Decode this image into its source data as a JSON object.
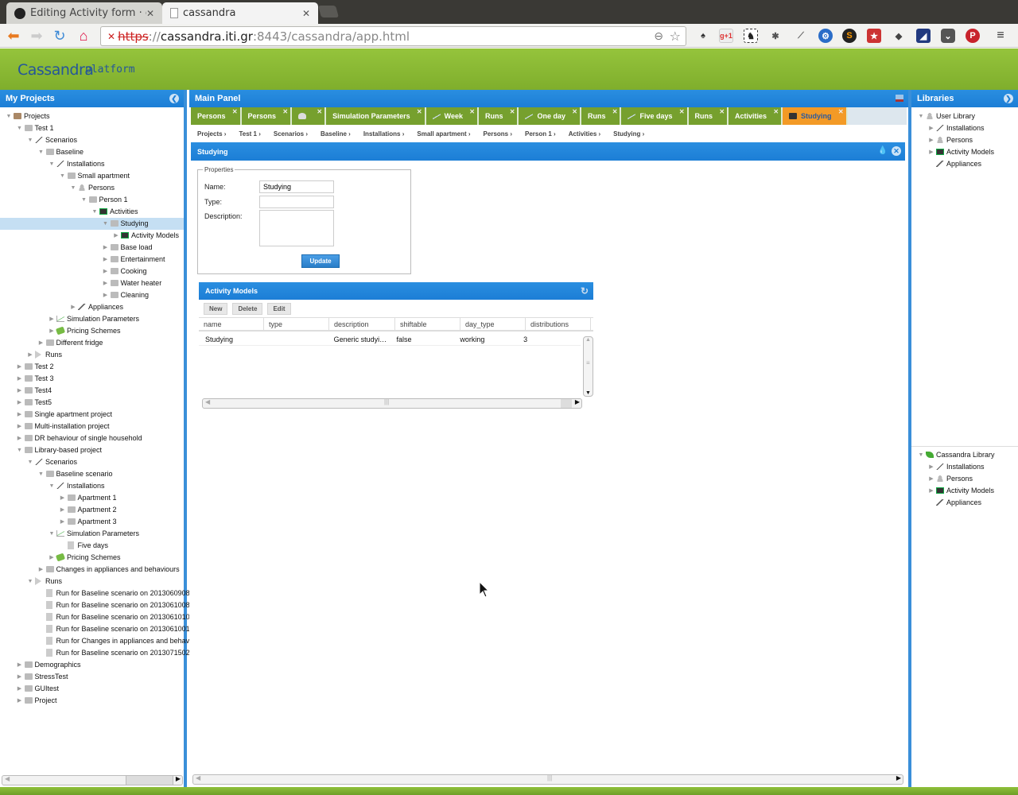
{
  "browser": {
    "tabs": [
      {
        "title": "Editing Activity form · cas",
        "icon": "github-icon",
        "active": false
      },
      {
        "title": "cassandra",
        "icon": "page-icon",
        "active": true
      }
    ],
    "url": {
      "scheme": "https",
      "host": "cassandra.iti.gr",
      "path": ":8443/cassandra/app.html"
    },
    "extensions": [
      "lamp-icon",
      "google-plus-one-icon",
      "evernote-icon",
      "bug-icon",
      "eyedropper-icon",
      "gear-badge-icon",
      "s-icon",
      "bookmark-icon",
      "feedly-icon",
      "speed-icon",
      "pocket-icon",
      "pinterest-icon"
    ]
  },
  "app": {
    "logo": "Cassandra",
    "subtitle": "platform"
  },
  "left_panel": {
    "title": "My Projects",
    "tree": [
      {
        "label": "Projects",
        "level": 0,
        "icon": "proj",
        "state": "open"
      },
      {
        "label": "Test 1",
        "level": 1,
        "icon": "folder",
        "state": "open"
      },
      {
        "label": "Scenarios",
        "level": 2,
        "icon": "wand",
        "state": "open"
      },
      {
        "label": "Baseline",
        "level": 3,
        "icon": "folder",
        "state": "open"
      },
      {
        "label": "Installations",
        "level": 4,
        "icon": "wand",
        "state": "open"
      },
      {
        "label": "Small apartment",
        "level": 5,
        "icon": "folder",
        "state": "open"
      },
      {
        "label": "Persons",
        "level": 6,
        "icon": "person",
        "state": "open"
      },
      {
        "label": "Person 1",
        "level": 7,
        "icon": "folder",
        "state": "open"
      },
      {
        "label": "Activities",
        "level": 8,
        "icon": "dark",
        "state": "open"
      },
      {
        "label": "Studying",
        "level": 9,
        "icon": "folder",
        "state": "open",
        "selected": true
      },
      {
        "label": "Activity Models",
        "level": 10,
        "icon": "dark",
        "state": "closed"
      },
      {
        "label": "Base load",
        "level": 9,
        "icon": "folder",
        "state": "closed"
      },
      {
        "label": "Entertainment",
        "level": 9,
        "icon": "folder",
        "state": "closed"
      },
      {
        "label": "Cooking",
        "level": 9,
        "icon": "folder",
        "state": "closed"
      },
      {
        "label": "Water heater",
        "level": 9,
        "icon": "folder",
        "state": "closed"
      },
      {
        "label": "Cleaning",
        "level": 9,
        "icon": "folder",
        "state": "closed"
      },
      {
        "label": "Appliances",
        "level": 6,
        "icon": "appl",
        "state": "closed"
      },
      {
        "label": "Simulation Parameters",
        "level": 4,
        "icon": "chart",
        "state": "closed"
      },
      {
        "label": "Pricing Schemes",
        "level": 4,
        "icon": "money",
        "state": "closed"
      },
      {
        "label": "Different fridge",
        "level": 3,
        "icon": "folder",
        "state": "closed"
      },
      {
        "label": "Runs",
        "level": 2,
        "icon": "play",
        "state": "closed"
      },
      {
        "label": "Test 2",
        "level": 1,
        "icon": "folder",
        "state": "closed"
      },
      {
        "label": "Test 3",
        "level": 1,
        "icon": "folder",
        "state": "closed"
      },
      {
        "label": "Test4",
        "level": 1,
        "icon": "folder",
        "state": "closed"
      },
      {
        "label": "Test5",
        "level": 1,
        "icon": "folder",
        "state": "closed"
      },
      {
        "label": "Single apartment project",
        "level": 1,
        "icon": "folder",
        "state": "closed"
      },
      {
        "label": "Multi-installation project",
        "level": 1,
        "icon": "folder",
        "state": "closed"
      },
      {
        "label": "DR behaviour of single household",
        "level": 1,
        "icon": "folder",
        "state": "closed"
      },
      {
        "label": "Library-based project",
        "level": 1,
        "icon": "folder",
        "state": "open"
      },
      {
        "label": "Scenarios",
        "level": 2,
        "icon": "wand",
        "state": "open"
      },
      {
        "label": "Baseline scenario",
        "level": 3,
        "icon": "folder",
        "state": "open"
      },
      {
        "label": "Installations",
        "level": 4,
        "icon": "wand",
        "state": "open"
      },
      {
        "label": "Apartment 1",
        "level": 5,
        "icon": "folder",
        "state": "closed"
      },
      {
        "label": "Apartment 2",
        "level": 5,
        "icon": "folder",
        "state": "closed"
      },
      {
        "label": "Apartment 3",
        "level": 5,
        "icon": "folder",
        "state": "closed"
      },
      {
        "label": "Simulation Parameters",
        "level": 4,
        "icon": "chart",
        "state": "open"
      },
      {
        "label": "Five days",
        "level": 5,
        "icon": "doc",
        "state": "leaf"
      },
      {
        "label": "Pricing Schemes",
        "level": 4,
        "icon": "money",
        "state": "closed"
      },
      {
        "label": "Changes in appliances and behaviours",
        "level": 3,
        "icon": "folder",
        "state": "closed"
      },
      {
        "label": "Runs",
        "level": 2,
        "icon": "play",
        "state": "open"
      },
      {
        "label": "Run for Baseline scenario on 2013060908",
        "level": 3,
        "icon": "doc",
        "state": "leaf"
      },
      {
        "label": "Run for Baseline scenario on 2013061008",
        "level": 3,
        "icon": "doc",
        "state": "leaf"
      },
      {
        "label": "Run for Baseline scenario on 2013061010",
        "level": 3,
        "icon": "doc",
        "state": "leaf"
      },
      {
        "label": "Run for Baseline scenario on 2013061001",
        "level": 3,
        "icon": "doc",
        "state": "leaf"
      },
      {
        "label": "Run for Changes in appliances and behavi",
        "level": 3,
        "icon": "doc",
        "state": "leaf"
      },
      {
        "label": "Run for Baseline scenario on 2013071502",
        "level": 3,
        "icon": "doc",
        "state": "leaf"
      },
      {
        "label": "Demographics",
        "level": 1,
        "icon": "folder",
        "state": "closed"
      },
      {
        "label": "StressTest",
        "level": 1,
        "icon": "folder",
        "state": "closed"
      },
      {
        "label": "GUItest",
        "level": 1,
        "icon": "folder",
        "state": "closed"
      },
      {
        "label": "Project",
        "level": 1,
        "icon": "folder",
        "state": "closed"
      }
    ]
  },
  "main_panel": {
    "title": "Main Panel",
    "tabs": [
      {
        "label": "Persons",
        "icon": null
      },
      {
        "label": "Persons",
        "icon": null
      },
      {
        "label": "",
        "icon": "person"
      },
      {
        "label": "Simulation Parameters",
        "icon": null
      },
      {
        "label": "Week",
        "icon": "chart"
      },
      {
        "label": "Runs",
        "icon": null
      },
      {
        "label": "One day",
        "icon": "chart"
      },
      {
        "label": "Runs",
        "icon": null
      },
      {
        "label": "Five days",
        "icon": "chart"
      },
      {
        "label": "Runs",
        "icon": null
      },
      {
        "label": "Activities",
        "icon": null
      },
      {
        "label": "Studying",
        "icon": "dark",
        "active": true
      }
    ],
    "breadcrumbs": [
      "Projects",
      "Test 1",
      "Scenarios",
      "Baseline",
      "Installations",
      "Small apartment",
      "Persons",
      "Person 1",
      "Activities",
      "Studying"
    ],
    "form_title": "Studying",
    "properties": {
      "legend": "Properties",
      "name_label": "Name:",
      "name_value": "Studying",
      "type_label": "Type:",
      "type_value": "",
      "description_label": "Description:",
      "description_value": "",
      "update_label": "Update"
    },
    "activity_models": {
      "title": "Activity Models",
      "buttons": {
        "new": "New",
        "delete": "Delete",
        "edit": "Edit"
      },
      "columns": [
        "name",
        "type",
        "description",
        "shiftable",
        "day_type",
        "distributions"
      ],
      "rows": [
        [
          "Studying",
          "",
          "Generic studyi…",
          "false",
          "working",
          "3"
        ]
      ]
    }
  },
  "right_panel": {
    "title": "Libraries",
    "user_library": [
      {
        "label": "User Library",
        "level": 0,
        "icon": "person",
        "state": "open"
      },
      {
        "label": "Installations",
        "level": 1,
        "icon": "wand",
        "state": "closed"
      },
      {
        "label": "Persons",
        "level": 1,
        "icon": "person",
        "state": "closed"
      },
      {
        "label": "Activity Models",
        "level": 1,
        "icon": "dark",
        "state": "closed"
      },
      {
        "label": "Appliances",
        "level": 1,
        "icon": "appl",
        "state": "leaf"
      }
    ],
    "cassandra_library": [
      {
        "label": "Cassandra Library",
        "level": 0,
        "icon": "leaf",
        "state": "open"
      },
      {
        "label": "Installations",
        "level": 1,
        "icon": "wand",
        "state": "closed"
      },
      {
        "label": "Persons",
        "level": 1,
        "icon": "person",
        "state": "closed"
      },
      {
        "label": "Activity Models",
        "level": 1,
        "icon": "dark",
        "state": "closed"
      },
      {
        "label": "Appliances",
        "level": 1,
        "icon": "appl",
        "state": "leaf"
      }
    ]
  }
}
